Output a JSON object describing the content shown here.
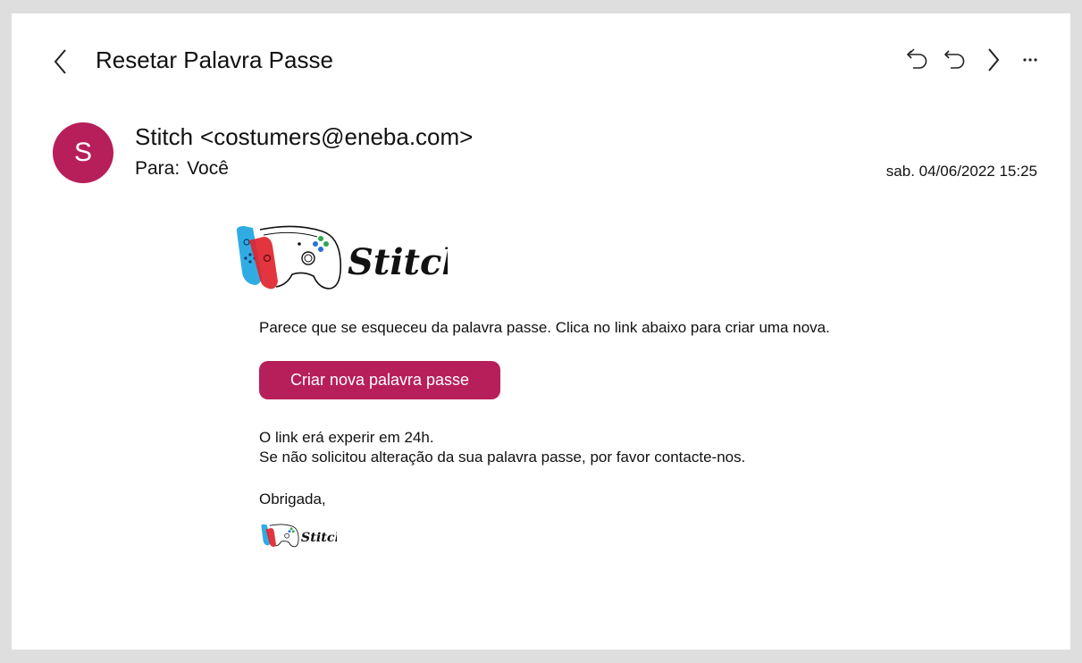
{
  "header": {
    "subject": "Resetar Palavra Passe",
    "back_icon": "chevron-left-icon",
    "toolbar_icons": [
      "reply-all-icon",
      "reply-icon",
      "forward-icon",
      "more-icon"
    ]
  },
  "sender": {
    "avatar_letter": "S",
    "avatar_color": "#b71f5a",
    "name": "Stitch",
    "email": "<costumers@eneba.com>"
  },
  "recipient": {
    "label": "Para:",
    "value": "Você"
  },
  "date": "sab. 04/06/2022 15:25",
  "body": {
    "intro": "Parece que se esqueceu da palavra passe. Clica no link abaixo para criar uma nova.",
    "button_label": "Criar nova palavra passe",
    "expiry": "O link erá experir em 24h.",
    "notice": "Se não solicitou alteração da sua palavra passe, por favor contacte-nos.",
    "signoff": "Obrigada,",
    "logo_text": "Stitch"
  },
  "colors": {
    "accent": "#b71f5a",
    "joycon_left": "#1aa3e0",
    "joycon_right": "#e0242c"
  }
}
